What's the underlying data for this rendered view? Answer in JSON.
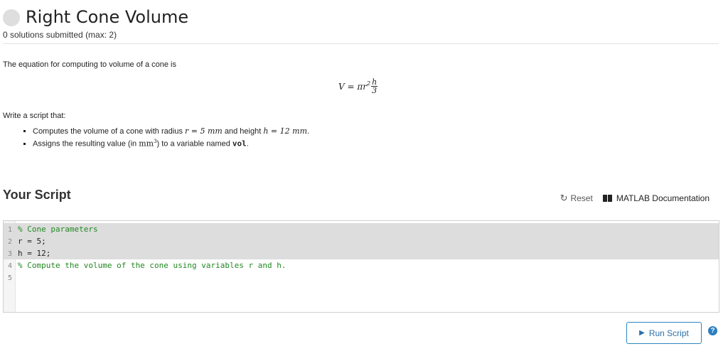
{
  "problem": {
    "title": "Right Cone Volume",
    "submissions": "0 solutions submitted (max: 2)"
  },
  "description": {
    "intro": "The equation for computing to volume of a cone is",
    "formula_lhs": "V = πr",
    "formula_exp": "2",
    "formula_num": "h",
    "formula_den": "3",
    "task_intro": "Write a script that:",
    "task1_pre": "Computes the volume of a cone with radius ",
    "task1_r": "r = 5 mm",
    "task1_mid": " and height ",
    "task1_h": "h = 12 mm",
    "task1_end": ".",
    "task2_pre": "Assigns the resulting value (in ",
    "task2_unit": "mm",
    "task2_exp": "3",
    "task2_mid": ") to a variable named ",
    "task2_var": "vol",
    "task2_end": "."
  },
  "script": {
    "heading": "Your Script",
    "reset_label": "Reset",
    "docs_label": "MATLAB Documentation",
    "lines": [
      {
        "num": "1",
        "code": "% Cone parameters"
      },
      {
        "num": "2",
        "code": "r = 5;"
      },
      {
        "num": "3",
        "code": "h = 12;"
      },
      {
        "num": "4",
        "code": "% Compute the volume of the cone using variables r and h."
      },
      {
        "num": "5",
        "code": ""
      }
    ]
  },
  "actions": {
    "run_label": "Run Script",
    "help_label": "?"
  },
  "icons": {
    "reset": "reset-icon",
    "docs": "book-icon",
    "run": "play-icon",
    "help": "help-icon"
  },
  "colors": {
    "accent": "#2e86c1",
    "comment": "#228822",
    "readonly_line": "#dddddd"
  }
}
